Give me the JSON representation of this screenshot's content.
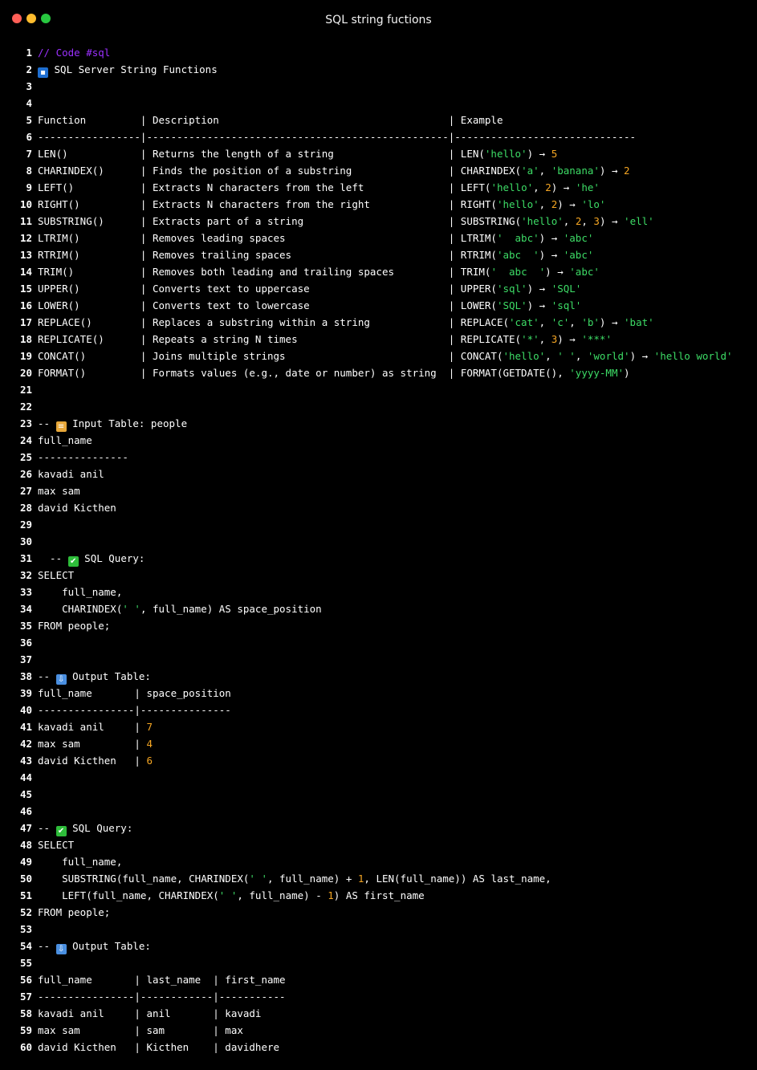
{
  "window": {
    "title": "SQL string fuctions",
    "buttons": [
      {
        "name": "close",
        "color": "#ff5f57"
      },
      {
        "name": "minimize",
        "color": "#febc2e"
      },
      {
        "name": "maximize",
        "color": "#28c840"
      }
    ]
  },
  "colors": {
    "background": "#000000",
    "text": "#ffffff",
    "string": "#3ddc66",
    "number": "#f5a623",
    "comment": "#9b30ff"
  },
  "icons": {
    "sql": {
      "name": "sql-badge-icon",
      "bg": "#1f6fd1",
      "glyph": "▪"
    },
    "books": {
      "name": "books-icon",
      "bg": "#e8a83a",
      "glyph": "≡"
    },
    "check": {
      "name": "check-mark-icon",
      "bg": "#2ebd3a",
      "glyph": "✔"
    },
    "inbox": {
      "name": "inbox-tray-icon",
      "bg": "#4a8fe0",
      "glyph": "⇩"
    }
  },
  "lines": [
    {
      "n": "1",
      "tokens": [
        {
          "t": "comment",
          "v": "// Code #sql"
        }
      ]
    },
    {
      "n": "2",
      "tokens": [
        {
          "icon": "sql"
        },
        {
          "t": "plain",
          "v": " SQL Server String Functions"
        }
      ]
    },
    {
      "n": "3",
      "tokens": []
    },
    {
      "n": "4",
      "tokens": []
    },
    {
      "n": "5",
      "tokens": [
        {
          "t": "plain",
          "v": "Function         | Description                                      | Example"
        }
      ]
    },
    {
      "n": "6",
      "tokens": [
        {
          "t": "plain",
          "v": "-----------------|--------------------------------------------------|------------------------------"
        }
      ]
    },
    {
      "n": "7",
      "tokens": [
        {
          "t": "plain",
          "v": "LEN()            | Returns the length of a string                   | LEN("
        },
        {
          "t": "str",
          "v": "'hello'"
        },
        {
          "t": "plain",
          "v": ") → "
        },
        {
          "t": "num",
          "v": "5"
        }
      ]
    },
    {
      "n": "8",
      "tokens": [
        {
          "t": "plain",
          "v": "CHARINDEX()      | Finds the position of a substring                | CHARINDEX("
        },
        {
          "t": "str",
          "v": "'a'"
        },
        {
          "t": "plain",
          "v": ", "
        },
        {
          "t": "str",
          "v": "'banana'"
        },
        {
          "t": "plain",
          "v": ") → "
        },
        {
          "t": "num",
          "v": "2"
        }
      ]
    },
    {
      "n": "9",
      "tokens": [
        {
          "t": "plain",
          "v": "LEFT()           | Extracts N characters from the left              | LEFT("
        },
        {
          "t": "str",
          "v": "'hello'"
        },
        {
          "t": "plain",
          "v": ", "
        },
        {
          "t": "num",
          "v": "2"
        },
        {
          "t": "plain",
          "v": ") → "
        },
        {
          "t": "str",
          "v": "'he'"
        }
      ]
    },
    {
      "n": "10",
      "tokens": [
        {
          "t": "plain",
          "v": "RIGHT()          | Extracts N characters from the right             | RIGHT("
        },
        {
          "t": "str",
          "v": "'hello'"
        },
        {
          "t": "plain",
          "v": ", "
        },
        {
          "t": "num",
          "v": "2"
        },
        {
          "t": "plain",
          "v": ") → "
        },
        {
          "t": "str",
          "v": "'lo'"
        }
      ]
    },
    {
      "n": "11",
      "tokens": [
        {
          "t": "plain",
          "v": "SUBSTRING()      | Extracts part of a string                        | SUBSTRING("
        },
        {
          "t": "str",
          "v": "'hello'"
        },
        {
          "t": "plain",
          "v": ", "
        },
        {
          "t": "num",
          "v": "2"
        },
        {
          "t": "plain",
          "v": ", "
        },
        {
          "t": "num",
          "v": "3"
        },
        {
          "t": "plain",
          "v": ") → "
        },
        {
          "t": "str",
          "v": "'ell'"
        }
      ]
    },
    {
      "n": "12",
      "tokens": [
        {
          "t": "plain",
          "v": "LTRIM()          | Removes leading spaces                           | LTRIM("
        },
        {
          "t": "str",
          "v": "'  abc'"
        },
        {
          "t": "plain",
          "v": ") → "
        },
        {
          "t": "str",
          "v": "'abc'"
        }
      ]
    },
    {
      "n": "13",
      "tokens": [
        {
          "t": "plain",
          "v": "RTRIM()          | Removes trailing spaces                          | RTRIM("
        },
        {
          "t": "str",
          "v": "'abc  '"
        },
        {
          "t": "plain",
          "v": ") → "
        },
        {
          "t": "str",
          "v": "'abc'"
        }
      ]
    },
    {
      "n": "14",
      "tokens": [
        {
          "t": "plain",
          "v": "TRIM()           | Removes both leading and trailing spaces         | TRIM("
        },
        {
          "t": "str",
          "v": "'  abc  '"
        },
        {
          "t": "plain",
          "v": ") → "
        },
        {
          "t": "str",
          "v": "'abc'"
        }
      ]
    },
    {
      "n": "15",
      "tokens": [
        {
          "t": "plain",
          "v": "UPPER()          | Converts text to uppercase                       | UPPER("
        },
        {
          "t": "str",
          "v": "'sql'"
        },
        {
          "t": "plain",
          "v": ") → "
        },
        {
          "t": "str",
          "v": "'SQL'"
        }
      ]
    },
    {
      "n": "16",
      "tokens": [
        {
          "t": "plain",
          "v": "LOWER()          | Converts text to lowercase                       | LOWER("
        },
        {
          "t": "str",
          "v": "'SQL'"
        },
        {
          "t": "plain",
          "v": ") → "
        },
        {
          "t": "str",
          "v": "'sql'"
        }
      ]
    },
    {
      "n": "17",
      "tokens": [
        {
          "t": "plain",
          "v": "REPLACE()        | Replaces a substring within a string             | REPLACE("
        },
        {
          "t": "str",
          "v": "'cat'"
        },
        {
          "t": "plain",
          "v": ", "
        },
        {
          "t": "str",
          "v": "'c'"
        },
        {
          "t": "plain",
          "v": ", "
        },
        {
          "t": "str",
          "v": "'b'"
        },
        {
          "t": "plain",
          "v": ") → "
        },
        {
          "t": "str",
          "v": "'bat'"
        }
      ]
    },
    {
      "n": "18",
      "tokens": [
        {
          "t": "plain",
          "v": "REPLICATE()      | Repeats a string N times                         | REPLICATE("
        },
        {
          "t": "str",
          "v": "'*'"
        },
        {
          "t": "plain",
          "v": ", "
        },
        {
          "t": "num",
          "v": "3"
        },
        {
          "t": "plain",
          "v": ") → "
        },
        {
          "t": "str",
          "v": "'***'"
        }
      ]
    },
    {
      "n": "19",
      "tokens": [
        {
          "t": "plain",
          "v": "CONCAT()         | Joins multiple strings                           | CONCAT("
        },
        {
          "t": "str",
          "v": "'hello'"
        },
        {
          "t": "plain",
          "v": ", "
        },
        {
          "t": "str",
          "v": "' '"
        },
        {
          "t": "plain",
          "v": ", "
        },
        {
          "t": "str",
          "v": "'world'"
        },
        {
          "t": "plain",
          "v": ") → "
        },
        {
          "t": "str",
          "v": "'hello world'"
        }
      ]
    },
    {
      "n": "20",
      "tokens": [
        {
          "t": "plain",
          "v": "FORMAT()         | Formats values (e.g., date or number) as string  | FORMAT(GETDATE(), "
        },
        {
          "t": "str",
          "v": "'yyyy-MM'"
        },
        {
          "t": "plain",
          "v": ")"
        }
      ]
    },
    {
      "n": "21",
      "tokens": []
    },
    {
      "n": "22",
      "tokens": []
    },
    {
      "n": "23",
      "tokens": [
        {
          "t": "plain",
          "v": "-- "
        },
        {
          "icon": "books"
        },
        {
          "t": "plain",
          "v": " Input Table: people"
        }
      ]
    },
    {
      "n": "24",
      "tokens": [
        {
          "t": "plain",
          "v": "full_name"
        }
      ]
    },
    {
      "n": "25",
      "tokens": [
        {
          "t": "plain",
          "v": "---------------"
        }
      ]
    },
    {
      "n": "26",
      "tokens": [
        {
          "t": "plain",
          "v": "kavadi anil"
        }
      ]
    },
    {
      "n": "27",
      "tokens": [
        {
          "t": "plain",
          "v": "max sam"
        }
      ]
    },
    {
      "n": "28",
      "tokens": [
        {
          "t": "plain",
          "v": "david Kicthen"
        }
      ]
    },
    {
      "n": "29",
      "tokens": []
    },
    {
      "n": "30",
      "tokens": []
    },
    {
      "n": "31",
      "tokens": [
        {
          "t": "plain",
          "v": "  -- "
        },
        {
          "icon": "check"
        },
        {
          "t": "plain",
          "v": " SQL Query:"
        }
      ]
    },
    {
      "n": "32",
      "tokens": [
        {
          "t": "plain",
          "v": "SELECT"
        }
      ]
    },
    {
      "n": "33",
      "tokens": [
        {
          "t": "plain",
          "v": "    full_name,"
        }
      ]
    },
    {
      "n": "34",
      "tokens": [
        {
          "t": "plain",
          "v": "    CHARINDEX("
        },
        {
          "t": "str",
          "v": "' '"
        },
        {
          "t": "plain",
          "v": ", full_name) AS space_position"
        }
      ]
    },
    {
      "n": "35",
      "tokens": [
        {
          "t": "plain",
          "v": "FROM people;"
        }
      ]
    },
    {
      "n": "36",
      "tokens": []
    },
    {
      "n": "37",
      "tokens": []
    },
    {
      "n": "38",
      "tokens": [
        {
          "t": "plain",
          "v": "-- "
        },
        {
          "icon": "inbox"
        },
        {
          "t": "plain",
          "v": " Output Table:"
        }
      ]
    },
    {
      "n": "39",
      "tokens": [
        {
          "t": "plain",
          "v": "full_name       | space_position"
        }
      ]
    },
    {
      "n": "40",
      "tokens": [
        {
          "t": "plain",
          "v": "----------------|---------------"
        }
      ]
    },
    {
      "n": "41",
      "tokens": [
        {
          "t": "plain",
          "v": "kavadi anil     | "
        },
        {
          "t": "num",
          "v": "7"
        }
      ]
    },
    {
      "n": "42",
      "tokens": [
        {
          "t": "plain",
          "v": "max sam         | "
        },
        {
          "t": "num",
          "v": "4"
        }
      ]
    },
    {
      "n": "43",
      "tokens": [
        {
          "t": "plain",
          "v": "david Kicthen   | "
        },
        {
          "t": "num",
          "v": "6"
        }
      ]
    },
    {
      "n": "44",
      "tokens": []
    },
    {
      "n": "45",
      "tokens": []
    },
    {
      "n": "46",
      "tokens": []
    },
    {
      "n": "47",
      "tokens": [
        {
          "t": "plain",
          "v": "-- "
        },
        {
          "icon": "check"
        },
        {
          "t": "plain",
          "v": " SQL Query:"
        }
      ]
    },
    {
      "n": "48",
      "tokens": [
        {
          "t": "plain",
          "v": "SELECT"
        }
      ]
    },
    {
      "n": "49",
      "tokens": [
        {
          "t": "plain",
          "v": "    full_name,"
        }
      ]
    },
    {
      "n": "50",
      "tokens": [
        {
          "t": "plain",
          "v": "    SUBSTRING(full_name, CHARINDEX("
        },
        {
          "t": "str",
          "v": "' '"
        },
        {
          "t": "plain",
          "v": ", full_name) + "
        },
        {
          "t": "num",
          "v": "1"
        },
        {
          "t": "plain",
          "v": ", LEN(full_name)) AS last_name,"
        }
      ]
    },
    {
      "n": "51",
      "tokens": [
        {
          "t": "plain",
          "v": "    LEFT(full_name, CHARINDEX("
        },
        {
          "t": "str",
          "v": "' '"
        },
        {
          "t": "plain",
          "v": ", full_name) - "
        },
        {
          "t": "num",
          "v": "1"
        },
        {
          "t": "plain",
          "v": ") AS first_name"
        }
      ]
    },
    {
      "n": "52",
      "tokens": [
        {
          "t": "plain",
          "v": "FROM people;"
        }
      ]
    },
    {
      "n": "53",
      "tokens": []
    },
    {
      "n": "54",
      "tokens": [
        {
          "t": "plain",
          "v": "-- "
        },
        {
          "icon": "inbox"
        },
        {
          "t": "plain",
          "v": " Output Table:"
        }
      ]
    },
    {
      "n": "55",
      "tokens": []
    },
    {
      "n": "56",
      "tokens": [
        {
          "t": "plain",
          "v": "full_name       | last_name  | first_name"
        }
      ]
    },
    {
      "n": "57",
      "tokens": [
        {
          "t": "plain",
          "v": "----------------|------------|-----------"
        }
      ]
    },
    {
      "n": "58",
      "tokens": [
        {
          "t": "plain",
          "v": "kavadi anil     | anil       | kavadi"
        }
      ]
    },
    {
      "n": "59",
      "tokens": [
        {
          "t": "plain",
          "v": "max sam         | sam        | max"
        }
      ]
    },
    {
      "n": "60",
      "tokens": [
        {
          "t": "plain",
          "v": "david Kicthen   | Kicthen    | davidhere"
        }
      ]
    }
  ]
}
